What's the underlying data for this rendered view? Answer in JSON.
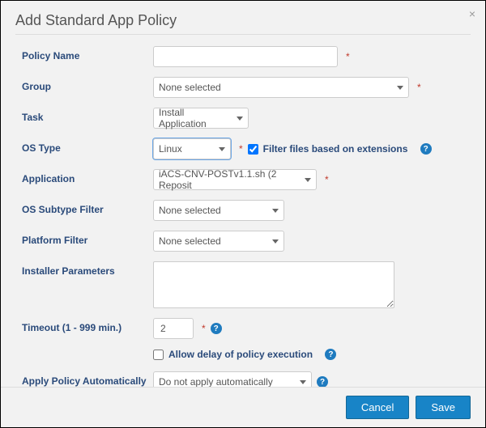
{
  "dialog": {
    "title": "Add Standard App Policy",
    "close": "×"
  },
  "labels": {
    "policy_name": "Policy Name",
    "group": "Group",
    "task": "Task",
    "os_type": "OS Type",
    "application": "Application",
    "os_subtype": "OS Subtype Filter",
    "platform": "Platform Filter",
    "installer_params": "Installer Parameters",
    "timeout": "Timeout (1 - 999 min.)",
    "allow_delay": "Allow delay of policy execution",
    "apply_auto": "Apply Policy Automatically",
    "filter_ext": "Filter files based on extensions"
  },
  "values": {
    "policy_name": "",
    "group": "None selected",
    "task": "Install Application",
    "os_type": "Linux",
    "application": "iACS-CNV-POSTv1.1.sh (2 Reposit",
    "os_subtype": "None selected",
    "platform": "None selected",
    "installer_params": "",
    "timeout": "2",
    "filter_ext_checked": true,
    "allow_delay_checked": false,
    "apply_auto": "Do not apply automatically"
  },
  "buttons": {
    "cancel": "Cancel",
    "save": "Save"
  },
  "icons": {
    "help": "?"
  }
}
